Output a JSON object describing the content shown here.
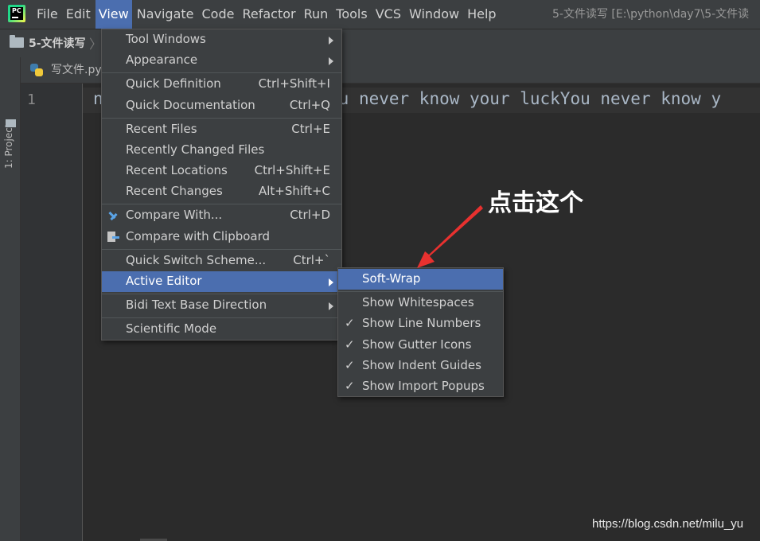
{
  "menubar": {
    "app_logo_text": "PC",
    "items": [
      "File",
      "Edit",
      "View",
      "Navigate",
      "Code",
      "Refactor",
      "Run",
      "Tools",
      "VCS",
      "Window",
      "Help"
    ],
    "active_item": "View",
    "title": "5-文件读写 [E:\\python\\day7\\5-文件读"
  },
  "navbar": {
    "project_name": "5-文件读写"
  },
  "side_panel": {
    "label": "1: Project"
  },
  "tab": {
    "file_name": "写文件.py"
  },
  "editor": {
    "line_number": "1",
    "code_text": "never know your luckYou never know your luckYou never know y",
    "code_visible_prefix": "n",
    "code_visible_suffix": "u never know your luckYou never know y"
  },
  "view_menu": {
    "items": [
      {
        "label": "Tool Windows",
        "shortcut": "",
        "submenu": true
      },
      {
        "label": "Appearance",
        "shortcut": "",
        "submenu": true
      },
      {
        "label": "Quick Definition",
        "shortcut": "Ctrl+Shift+I"
      },
      {
        "label": "Quick Documentation",
        "shortcut": "Ctrl+Q"
      },
      {
        "label": "Recent Files",
        "shortcut": "Ctrl+E"
      },
      {
        "label": "Recently Changed Files",
        "shortcut": ""
      },
      {
        "label": "Recent Locations",
        "shortcut": "Ctrl+Shift+E"
      },
      {
        "label": "Recent Changes",
        "shortcut": "Alt+Shift+C"
      },
      {
        "label": "Compare With...",
        "shortcut": "Ctrl+D",
        "icon": "compare-icon"
      },
      {
        "label": "Compare with Clipboard",
        "shortcut": "",
        "icon": "clipboard-compare-icon"
      },
      {
        "label": "Quick Switch Scheme...",
        "shortcut": "Ctrl+`"
      },
      {
        "label": "Active Editor",
        "shortcut": "",
        "submenu": true,
        "highlighted": true
      },
      {
        "label": "Bidi Text Base Direction",
        "shortcut": "",
        "submenu": true
      },
      {
        "label": "Scientific Mode",
        "shortcut": ""
      }
    ]
  },
  "active_editor_menu": {
    "items": [
      {
        "label": "Soft-Wrap",
        "checked": false,
        "highlighted": true
      },
      {
        "label": "Show Whitespaces",
        "checked": false
      },
      {
        "label": "Show Line Numbers",
        "checked": true
      },
      {
        "label": "Show Gutter Icons",
        "checked": true
      },
      {
        "label": "Show Indent Guides",
        "checked": true
      },
      {
        "label": "Show Import Popups",
        "checked": true
      }
    ],
    "check_glyph": "✓"
  },
  "annotation": {
    "text": "点击这个",
    "arrow_color": "#e8312f"
  },
  "watermark": {
    "text": "https://blog.csdn.net/milu_yu"
  },
  "colors": {
    "highlight": "#4b6eaf",
    "menubar_bg": "#3c3f41",
    "editor_bg": "#2b2b2b"
  }
}
